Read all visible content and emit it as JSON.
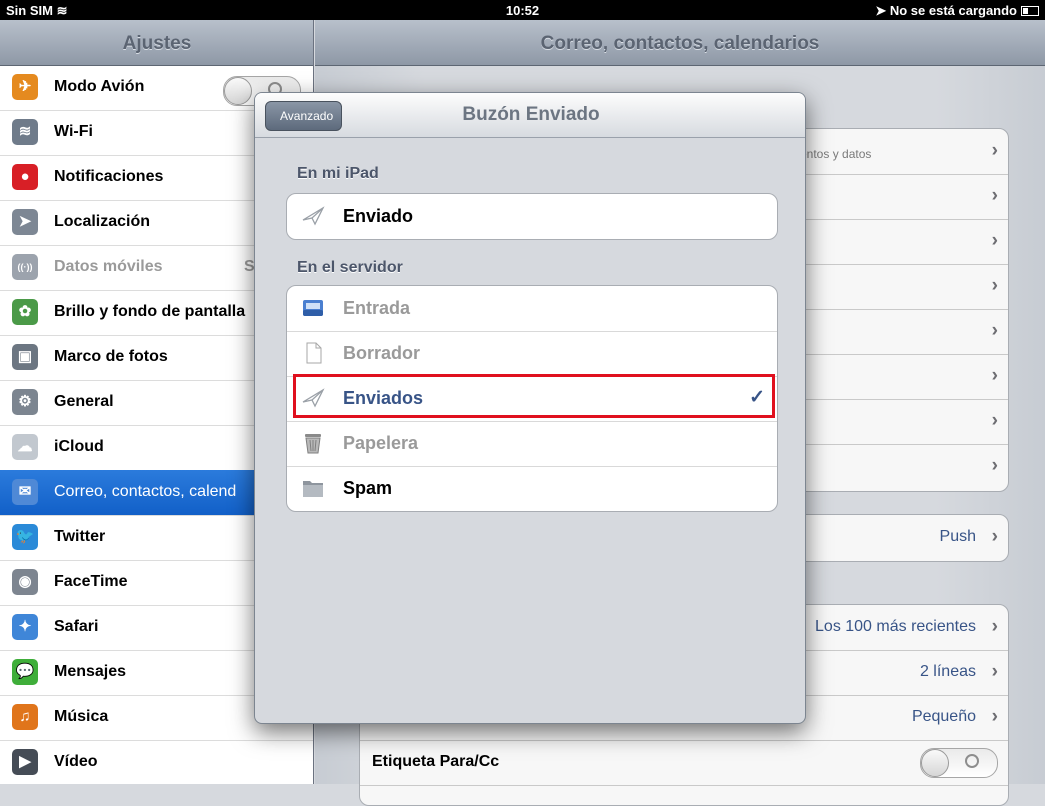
{
  "status_bar": {
    "carrier": "Sin SIM",
    "time": "10:52",
    "charging": "No se está cargando"
  },
  "sidebar": {
    "title": "Ajustes",
    "items": [
      {
        "label": "Modo Avión",
        "icon": "airplane-icon",
        "color": "#e58a1f"
      },
      {
        "label": "Wi-Fi",
        "icon": "wifi-icon",
        "color": "#6f7b8a"
      },
      {
        "label": "Notificaciones",
        "icon": "notifications-icon",
        "color": "#d81f26"
      },
      {
        "label": "Localización",
        "icon": "location-icon",
        "color": "#7d8794"
      },
      {
        "label": "Datos móviles",
        "icon": "cellular-icon",
        "color": "#9ca3ad",
        "value": "S"
      },
      {
        "label": "Brillo y fondo de pantalla",
        "icon": "brightness-icon",
        "color": "#4b9a48"
      },
      {
        "label": "Marco de fotos",
        "icon": "picture-frame-icon",
        "color": "#6c7682"
      },
      {
        "label": "General",
        "icon": "gear-icon",
        "color": "#7c8590"
      },
      {
        "label": "iCloud",
        "icon": "icloud-icon",
        "color": "#c2c8cf"
      },
      {
        "label": "Correo, contactos, calend",
        "icon": "mail-icon",
        "color": "#4f89d6"
      },
      {
        "label": "Twitter",
        "icon": "twitter-icon",
        "color": "#2a8ad8"
      },
      {
        "label": "FaceTime",
        "icon": "facetime-icon",
        "color": "#7d8590"
      },
      {
        "label": "Safari",
        "icon": "safari-icon",
        "color": "#3f86d8"
      },
      {
        "label": "Mensajes",
        "icon": "messages-icon",
        "color": "#3fae3a"
      },
      {
        "label": "Música",
        "icon": "music-icon",
        "color": "#e0751b"
      },
      {
        "label": "Vídeo",
        "icon": "video-icon",
        "color": "#454c56"
      }
    ]
  },
  "main": {
    "title": "Correo, contactos, calendarios",
    "account_subtitle": "entos y datos",
    "fetch_value": "Push",
    "show_value": "Los 100 más recientes",
    "preview_value": "2 líneas",
    "font_size_value": "Pequeño",
    "to_cc_label": "Etiqueta Para/Cc"
  },
  "popover": {
    "back_label": "Avanzado",
    "title": "Buzón Enviado",
    "section_local": "En mi iPad",
    "local_items": [
      {
        "label": "Enviado",
        "icon": "paper-plane-icon"
      }
    ],
    "section_server": "En el servidor",
    "server_items": [
      {
        "label": "Entrada",
        "icon": "inbox-icon",
        "state": "dim"
      },
      {
        "label": "Borrador",
        "icon": "draft-icon",
        "state": "dim"
      },
      {
        "label": "Enviados",
        "icon": "paper-plane-icon",
        "state": "selected"
      },
      {
        "label": "Papelera",
        "icon": "trash-icon",
        "state": "dim"
      },
      {
        "label": "Spam",
        "icon": "folder-icon",
        "state": "normal"
      }
    ],
    "checkmark": "✓"
  },
  "colors": {
    "selection_blue": "#1a67cf",
    "value_blue": "#385487",
    "highlight_red": "#e0101e"
  }
}
